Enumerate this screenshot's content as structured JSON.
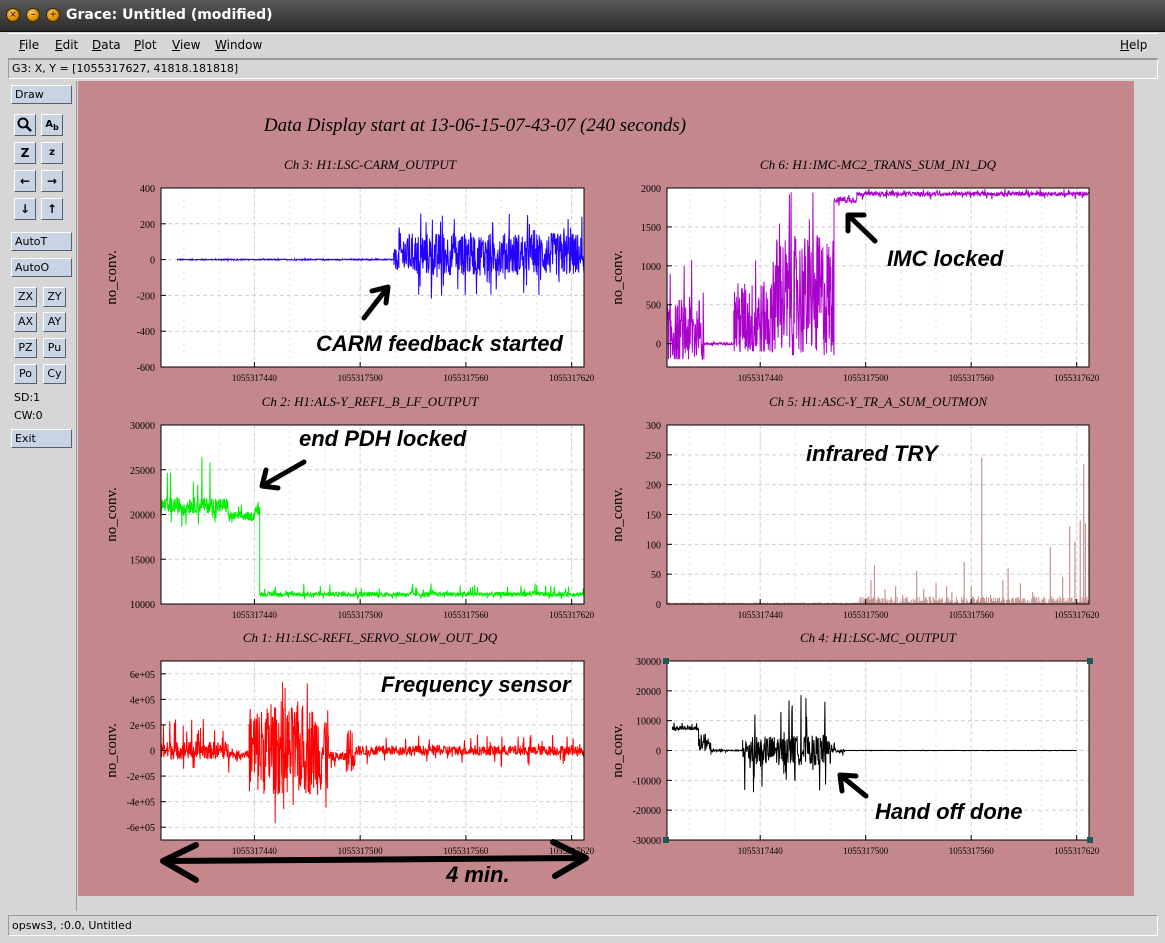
{
  "window": {
    "title": "Grace: Untitled (modified)"
  },
  "menubar": {
    "items": [
      {
        "label": "File",
        "key": "F",
        "rest": "ile"
      },
      {
        "label": "Edit",
        "key": "E",
        "rest": "dit"
      },
      {
        "label": "Data",
        "key": "D",
        "rest": "ata"
      },
      {
        "label": "Plot",
        "key": "P",
        "rest": "lot"
      },
      {
        "label": "View",
        "key": "V",
        "rest": "iew"
      },
      {
        "label": "Window",
        "key": "W",
        "rest": "indow"
      },
      {
        "label": "Help",
        "key": "H",
        "rest": "elp"
      }
    ]
  },
  "locator": "G3: X, Y = [1055317627, 41818.181818]",
  "toolbox": {
    "draw": "Draw",
    "icons": [
      "zoom-icon",
      "autoscale-text-icon",
      "zoom-in-icon",
      "zoom-out-icon",
      "left-arrow-icon",
      "right-arrow-icon",
      "down-arrow-icon",
      "up-arrow-icon"
    ],
    "autot": "AutoT",
    "autoo": "AutoO",
    "pairs": [
      [
        "ZX",
        "ZY"
      ],
      [
        "AX",
        "AY"
      ],
      [
        "PZ",
        "Pu"
      ],
      [
        "Po",
        "Cy"
      ]
    ],
    "sd": "SD:1",
    "cw": "CW:0",
    "exit": "Exit"
  },
  "status": "opsws3, :0.0, Untitled",
  "colors": {
    "canvas_bg": "#c4888c",
    "plot_bg": "#ffffff",
    "grid": "#cfcfcf"
  },
  "page_title": "Data Display start at 13-06-15-07-43-07 (240 seconds)",
  "annotations": {
    "carm": "CARM feedback started",
    "imc": "IMC locked",
    "pdh": "end PDH locked",
    "try": "infrared TRY",
    "freq": "Frequency sensor",
    "handoff": "Hand off done",
    "span": "4 min."
  },
  "chart_data": [
    {
      "id": "ch3",
      "type": "line",
      "title": "Ch 3: H1:LSC-CARM_OUTPUT",
      "ylabel": "no_conv.",
      "color": "#2200ff",
      "xlim": [
        1055317387,
        1055317627
      ],
      "ylim": [
        -600,
        400
      ],
      "yticks": [
        400,
        200,
        0,
        -200,
        -400,
        -600
      ],
      "ytick_labels": [
        "400",
        "200",
        "0",
        "-200",
        "-400",
        "-600"
      ],
      "xticks": [
        1055317440,
        1055317500,
        1055317560,
        1055317620
      ],
      "xtick_labels": [
        "1055317440",
        "1055317500",
        "1055317560",
        "1055317620"
      ],
      "grid": true,
      "segments": [
        {
          "from": 1055317396,
          "to": 1055317519,
          "level": 0,
          "noise": 3,
          "min": -5,
          "max": 5
        },
        {
          "from": 1055317519,
          "to": 1055317522,
          "level": 0,
          "noise": 60,
          "min": -60,
          "max": 60
        },
        {
          "from": 1055317522,
          "to": 1055317627,
          "level": 30,
          "noise": 120,
          "min": -230,
          "max": 260
        }
      ]
    },
    {
      "id": "ch6",
      "type": "line",
      "title": "Ch 6: H1:IMC-MC2_TRANS_SUM_IN1_DQ",
      "ylabel": "no_conv.",
      "color": "#aa00cc",
      "xlim": [
        1055317387,
        1055317627
      ],
      "ylim": [
        -300,
        2000
      ],
      "yticks": [
        2000,
        1500,
        1000,
        500,
        0
      ],
      "ytick_labels": [
        "2000",
        "1500",
        "1000",
        "500",
        "0"
      ],
      "xticks": [
        1055317440,
        1055317500,
        1055317560,
        1055317620
      ],
      "xtick_labels": [
        "1055317440",
        "1055317500",
        "1055317560",
        "1055317620"
      ],
      "grid": true,
      "segments": [
        {
          "from": 1055317387,
          "to": 1055317408,
          "level": 150,
          "noise": 450,
          "min": -200,
          "max": 1100
        },
        {
          "from": 1055317408,
          "to": 1055317425,
          "level": 0,
          "noise": 15,
          "min": -30,
          "max": 50
        },
        {
          "from": 1055317425,
          "to": 1055317447,
          "level": 300,
          "noise": 500,
          "min": -100,
          "max": 1100
        },
        {
          "from": 1055317447,
          "to": 1055317482,
          "level": 600,
          "noise": 800,
          "min": -150,
          "max": 1950
        },
        {
          "from": 1055317482,
          "to": 1055317495,
          "level": 1850,
          "noise": 40,
          "min": 1760,
          "max": 1960
        },
        {
          "from": 1055317495,
          "to": 1055317627,
          "level": 1925,
          "noise": 25,
          "min": 1850,
          "max": 1990
        }
      ]
    },
    {
      "id": "ch2",
      "type": "line",
      "title": "Ch 2: H1:ALS-Y_REFL_B_LF_OUTPUT",
      "ylabel": "no_conv.",
      "color": "#00ee00",
      "xlim": [
        1055317387,
        1055317627
      ],
      "ylim": [
        10000,
        30000
      ],
      "yticks": [
        30000,
        25000,
        20000,
        15000,
        10000
      ],
      "ytick_labels": [
        "30000",
        "25000",
        "20000",
        "15000",
        "10000"
      ],
      "xticks": [
        1055317440,
        1055317500,
        1055317560,
        1055317620
      ],
      "xtick_labels": [
        "1055317440",
        "1055317500",
        "1055317560",
        "1055317620"
      ],
      "grid": true,
      "segments": [
        {
          "from": 1055317387,
          "to": 1055317425,
          "level": 21000,
          "noise": 900,
          "min": 18500,
          "max": 26500
        },
        {
          "from": 1055317425,
          "to": 1055317440,
          "level": 19800,
          "noise": 500,
          "min": 19000,
          "max": 21500
        },
        {
          "from": 1055317440,
          "to": 1055317443,
          "level": 20500,
          "noise": 600,
          "min": 19500,
          "max": 21500
        },
        {
          "from": 1055317443,
          "to": 1055317627,
          "level": 11100,
          "noise": 250,
          "min": 10500,
          "max": 12300
        }
      ]
    },
    {
      "id": "ch5",
      "type": "spikes",
      "title": "Ch 5: H1:ASC-Y_TR_A_SUM_OUTMON",
      "ylabel": "no_conv.",
      "color": "#c89090",
      "xlim": [
        1055317387,
        1055317627
      ],
      "ylim": [
        0,
        300
      ],
      "yticks": [
        300,
        250,
        200,
        150,
        100,
        50,
        0
      ],
      "ytick_labels": [
        "300",
        "250",
        "200",
        "150",
        "100",
        "50",
        "0"
      ],
      "xticks": [
        1055317440,
        1055317500,
        1055317560,
        1055317620
      ],
      "xtick_labels": [
        "1055317440",
        "1055317500",
        "1055317560",
        "1055317620"
      ],
      "grid": true,
      "spikes": [
        [
          1055317503,
          40
        ],
        [
          1055317505,
          65
        ],
        [
          1055317511,
          25
        ],
        [
          1055317517,
          30
        ],
        [
          1055317521,
          15
        ],
        [
          1055317529,
          55
        ],
        [
          1055317533,
          25
        ],
        [
          1055317540,
          35
        ],
        [
          1055317546,
          30
        ],
        [
          1055317549,
          20
        ],
        [
          1055317556,
          70
        ],
        [
          1055317560,
          30
        ],
        [
          1055317566,
          245
        ],
        [
          1055317571,
          15
        ],
        [
          1055317578,
          40
        ],
        [
          1055317581,
          60
        ],
        [
          1055317588,
          35
        ],
        [
          1055317595,
          20
        ],
        [
          1055317605,
          95
        ],
        [
          1055317612,
          45
        ],
        [
          1055317616,
          130
        ],
        [
          1055317619,
          105
        ],
        [
          1055317622,
          140
        ],
        [
          1055317624,
          235
        ],
        [
          1055317625,
          135
        ]
      ]
    },
    {
      "id": "ch1",
      "type": "line",
      "title": "Ch 1: H1:LSC-REFL_SERVO_SLOW_OUT_DQ",
      "ylabel": "no_conv.",
      "color": "#ff0000",
      "xlim": [
        1055317387,
        1055317627
      ],
      "ylim": [
        -700000,
        700000
      ],
      "yticks": [
        600000,
        400000,
        200000,
        0,
        -200000,
        -400000,
        -600000
      ],
      "ytick_labels": [
        "6e+05",
        "4e+05",
        "2e+05",
        "0",
        "-2e+05",
        "-4e+05",
        "-6e+05"
      ],
      "xticks": [
        1055317440,
        1055317500,
        1055317560,
        1055317620
      ],
      "xtick_labels": [
        "1055317440",
        "1055317500",
        "1055317560",
        "1055317620"
      ],
      "grid": true,
      "segments": [
        {
          "from": 1055317387,
          "to": 1055317426,
          "level": 0,
          "noise": 70000,
          "min": -200000,
          "max": 250000
        },
        {
          "from": 1055317426,
          "to": 1055317437,
          "level": -30000,
          "noise": 30000,
          "min": -90000,
          "max": 30000
        },
        {
          "from": 1055317437,
          "to": 1055317482,
          "level": 0,
          "noise": 350000,
          "min": -620000,
          "max": 590000
        },
        {
          "from": 1055317482,
          "to": 1055317492,
          "level": -50000,
          "noise": 40000,
          "min": -150000,
          "max": 50000
        },
        {
          "from": 1055317492,
          "to": 1055317497,
          "level": 0,
          "noise": 170000,
          "min": -220000,
          "max": 200000
        },
        {
          "from": 1055317497,
          "to": 1055317627,
          "level": 0,
          "noise": 40000,
          "min": -130000,
          "max": 130000
        }
      ]
    },
    {
      "id": "ch4",
      "type": "line",
      "title": "Ch 4: H1:LSC-MC_OUTPUT",
      "ylabel": "no_conv.",
      "color": "#000000",
      "xlim": [
        1055317387,
        1055317627
      ],
      "ylim": [
        -30000,
        30000
      ],
      "yticks": [
        30000,
        20000,
        10000,
        0,
        -10000,
        -20000,
        -30000
      ],
      "ytick_labels": [
        "30000",
        "20000",
        "10000",
        "0",
        "-10000",
        "-20000",
        "-30000"
      ],
      "xticks": [
        1055317440,
        1055317500,
        1055317560,
        1055317620
      ],
      "xtick_labels": [
        "1055317440",
        "1055317500",
        "1055317560",
        "1055317620"
      ],
      "grid": true,
      "segments": [
        {
          "from": 1055317390,
          "to": 1055317405,
          "level": 7500,
          "noise": 700,
          "min": 5500,
          "max": 9500
        },
        {
          "from": 1055317405,
          "to": 1055317412,
          "level": 2000,
          "noise": 2000,
          "min": -2000,
          "max": 6000
        },
        {
          "from": 1055317412,
          "to": 1055317430,
          "level": 0,
          "noise": 200,
          "min": -800,
          "max": 800
        },
        {
          "from": 1055317430,
          "to": 1055317480,
          "level": 0,
          "noise": 5000,
          "min": -14000,
          "max": 20000
        },
        {
          "from": 1055317480,
          "to": 1055317488,
          "level": 0,
          "noise": 800,
          "min": -3000,
          "max": 3000
        },
        {
          "from": 1055317488,
          "to": 1055317620,
          "level": 0,
          "noise": 30,
          "min": -100,
          "max": 100
        }
      ]
    }
  ]
}
